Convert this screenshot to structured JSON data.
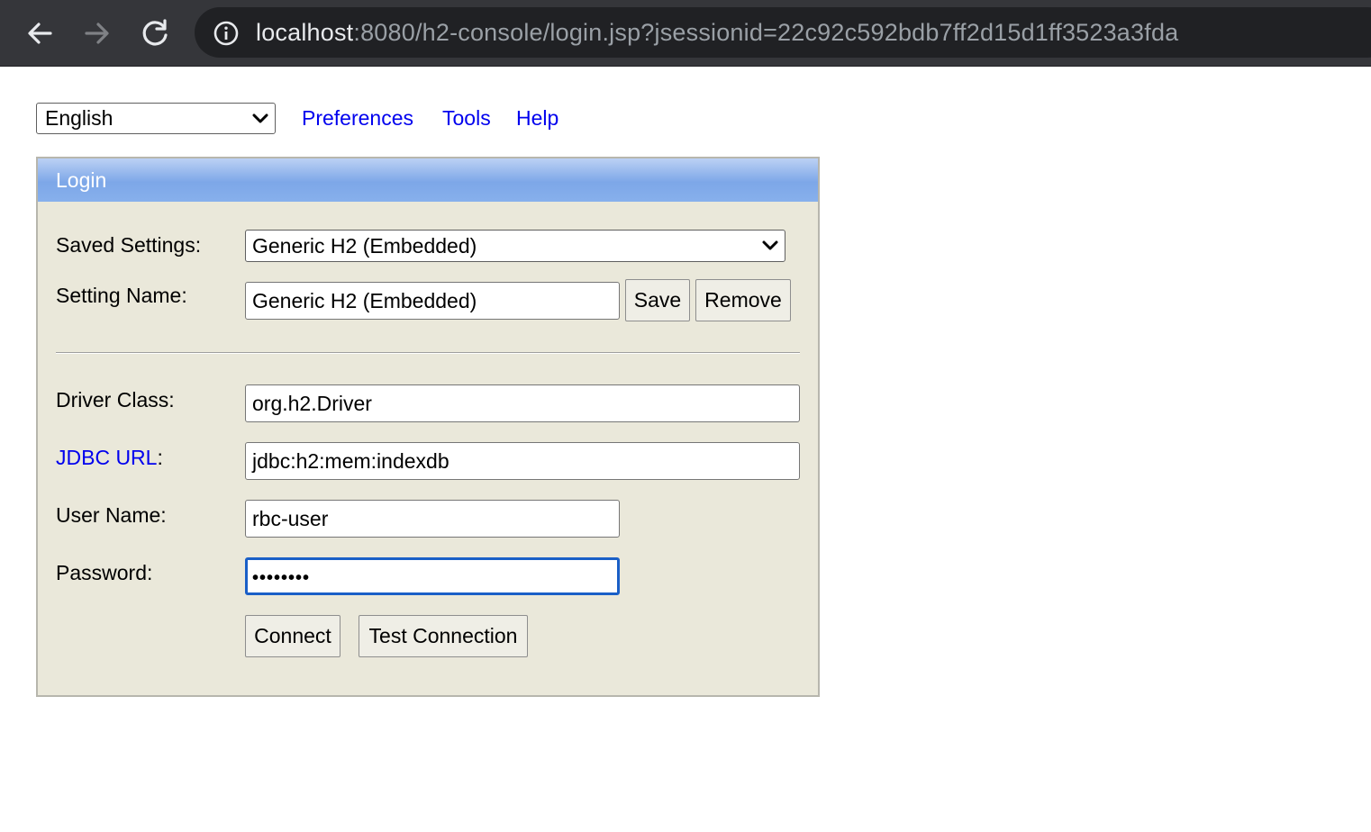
{
  "browser": {
    "url_host": "localhost",
    "url_rest": ":8080/h2-console/login.jsp?jsessionid=22c92c592bdb7ff2d15d1ff3523a3fda"
  },
  "topbar": {
    "language": "English",
    "links": [
      "Preferences",
      "Tools",
      "Help"
    ]
  },
  "login": {
    "title": "Login",
    "saved_settings_label": "Saved Settings:",
    "saved_settings_value": "Generic H2 (Embedded)",
    "setting_name_label": "Setting Name:",
    "setting_name_value": "Generic H2 (Embedded)",
    "save_button": "Save",
    "remove_button": "Remove",
    "driver_class_label": "Driver Class:",
    "driver_class_value": "org.h2.Driver",
    "jdbc_url_link": "JDBC URL",
    "jdbc_url_colon": ":",
    "jdbc_url_value": "jdbc:h2:mem:indexdb",
    "user_name_label": "User Name:",
    "user_name_value": "rbc-user",
    "password_label": "Password:",
    "password_masked": "••••••••",
    "connect_button": "Connect",
    "test_connection_button": "Test Connection"
  },
  "colors": {
    "link": "#0000ee",
    "panel_bg": "#eae8da",
    "header_blue": "#7da7e8",
    "focus_ring": "#1a5fc7",
    "chrome_bg": "#35363a"
  }
}
